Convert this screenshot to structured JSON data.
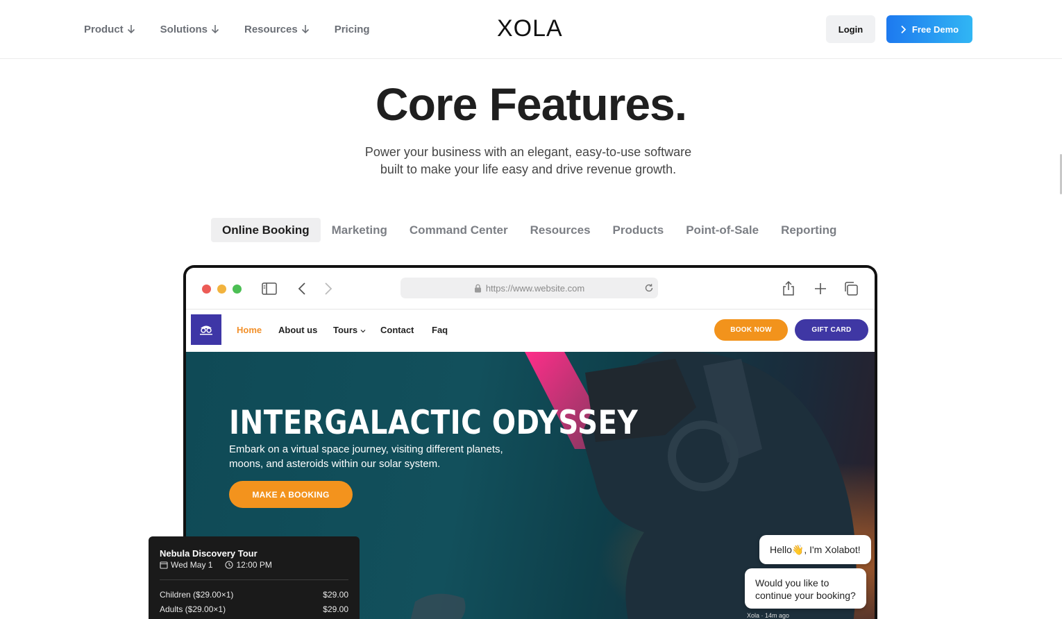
{
  "header": {
    "nav": [
      {
        "label": "Product",
        "has_arrow": true
      },
      {
        "label": "Solutions",
        "has_arrow": true
      },
      {
        "label": "Resources",
        "has_arrow": true
      },
      {
        "label": "Pricing",
        "has_arrow": false
      }
    ],
    "logo": "XOLA",
    "login_label": "Login",
    "demo_label": "Free Demo"
  },
  "hero": {
    "title": "Core Features.",
    "subtitle_line1": "Power your business with an elegant, easy-to-use software",
    "subtitle_line2": "built to make your life easy and drive revenue growth."
  },
  "tabs": [
    "Online Booking",
    "Marketing",
    "Command Center",
    "Resources",
    "Products",
    "Point-of-Sale",
    "Reporting"
  ],
  "active_tab": "Online Booking",
  "browser": {
    "url": "https://www.website.com",
    "site": {
      "nav": [
        "Home",
        "About us",
        "Tours",
        "Contact",
        "Faq"
      ],
      "book_label": "BOOK NOW",
      "gift_label": "GIFT CARD",
      "hero_title": "INTERGALACTIC ODYSSEY",
      "hero_desc": "Embark on a virtual space journey, visiting different planets, moons, and asteroids within our solar system.",
      "hero_button": "MAKE A BOOKING"
    }
  },
  "booking_card": {
    "title": "Nebula Discovery Tour",
    "date": "Wed May 1",
    "time": "12:00 PM",
    "rows": [
      {
        "label": "Children  ($29.00×1)",
        "price": "$29.00"
      },
      {
        "label": "Adults  ($29.00×1)",
        "price": "$29.00"
      }
    ]
  },
  "chat": {
    "greeting": "Hello👋, I'm Xolabot!",
    "question_line1": "Would you like to",
    "question_line2": "continue your booking?",
    "meta": "Xola · 14m ago"
  },
  "colors": {
    "accent_blue": "#1d79ef",
    "accent_orange": "#f2931c",
    "accent_purple": "#3f37a4"
  }
}
